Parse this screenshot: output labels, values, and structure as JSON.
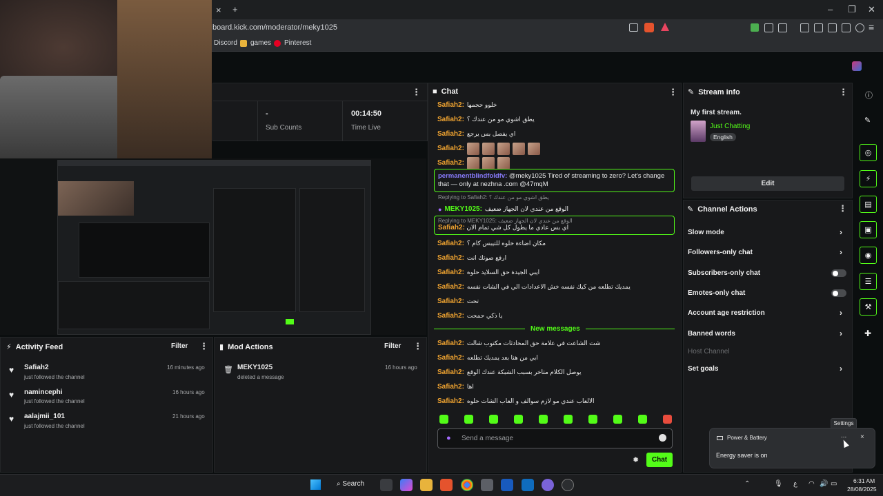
{
  "browser": {
    "url": "board.kick.com/moderator/meky1025",
    "close_tab": "×",
    "new_tab": "+",
    "bookmarks": [
      "Discord",
      "games",
      "Pinterest"
    ]
  },
  "stats": {
    "viewers_value": "-",
    "viewers_label": "Sub Counts",
    "time_value": "00:14:50",
    "time_label": "Time Live"
  },
  "chat": {
    "title": "Chat",
    "messages": [
      {
        "user": "Safiah2:",
        "text": "خلوو حجمها"
      },
      {
        "user": "Safiah2:",
        "text": "يطق اشوي مو من عندك ؟"
      },
      {
        "user": "Safiah2:",
        "text": "اي يفصل بس يرجع"
      }
    ],
    "emote_user1": "Safiah2:",
    "emote_user2": "Safiah2:",
    "highlight1_user": "permanentblindfoldfv:",
    "highlight1_text": "@meky1025 Tired of streaming to zero? Let's change that — only at nezhna .com @47mqM",
    "reply1_ref": "Replying to Safiah2: يطق اشوي مو من عندك ؟",
    "reply1_user": "MEKY1025:",
    "reply1_text": "الوقع من عندي لان الجهاز ضعيف",
    "reply2_ref": "Replying to MEKY1025: الوقع من عندي لان الجهاز ضعيف",
    "reply2_user": "Safiah2:",
    "reply2_text": "اي بس عادي ما يطول كل شي تمام الان",
    "messages2": [
      {
        "user": "Safiah2:",
        "text": "مكان اضاءة خلوه للتيبس كام ؟"
      },
      {
        "user": "Safiah2:",
        "text": "ارفع صوتك انت"
      },
      {
        "user": "Safiah2:",
        "text": "ايبي الجيدة حق السلايد حلوه"
      },
      {
        "user": "Safiah2:",
        "text": "يمديك تطلعه من كيك نفسه خش الاعدادات الي في الشات نفسه"
      },
      {
        "user": "Safiah2:",
        "text": "تحت"
      },
      {
        "user": "Safiah2:",
        "text": "يا ذكي حمحت"
      }
    ],
    "new_messages": "New messages",
    "messages3": [
      {
        "user": "Safiah2:",
        "text": "شت الشاعت في علامة حق المحادثات مكتوب شالت"
      },
      {
        "user": "Safiah2:",
        "text": "ابي من هنا بعد يمديك تطلعه"
      },
      {
        "user": "Safiah2:",
        "text": "يوصل الكلام متاخر بسبب الشبكة عندك الوقع"
      },
      {
        "user": "Safiah2:",
        "text": "اها"
      },
      {
        "user": "Safiah2:",
        "text": "الالعاب عندي مو لازم سوالف و العاب الشات حلوه"
      }
    ],
    "input_placeholder": "Send a message",
    "send_label": "Chat"
  },
  "stream_info": {
    "title": "Stream info",
    "stream_title": "My first stream.",
    "category": "Just Chatting",
    "language": "English",
    "edit_label": "Edit"
  },
  "channel_actions": {
    "title": "Channel Actions",
    "items": [
      "Slow mode",
      "Followers-only chat",
      "Subscribers-only chat",
      "Emotes-only chat",
      "Account age restriction",
      "Banned words",
      "Host Channel",
      "Set goals"
    ]
  },
  "activity": {
    "title": "Activity Feed",
    "filter": "Filter",
    "items": [
      {
        "name": "Safiah2",
        "sub": "just followed the channel",
        "time": "16 minutes ago"
      },
      {
        "name": "namincephi",
        "sub": "just followed the channel",
        "time": "16 hours ago"
      },
      {
        "name": "aalajmii_101",
        "sub": "just followed the channel",
        "time": "21 hours ago"
      }
    ]
  },
  "mod_actions": {
    "title": "Mod Actions",
    "filter": "Filter",
    "item_name": "MEKY1025",
    "item_sub": "deleted a message",
    "item_time": "16 hours ago"
  },
  "toast": {
    "title": "Power & Battery",
    "body": "Energy saver is on",
    "tooltip": "Settings",
    "more": "...",
    "close": "×"
  },
  "taskbar": {
    "search": "Search",
    "lang": "ع",
    "time": "6:31 AM",
    "date": "28/08/2025"
  },
  "colors": {
    "accent": "#53fc18",
    "username": "#f2a531",
    "highlight": "#8a7cff"
  }
}
